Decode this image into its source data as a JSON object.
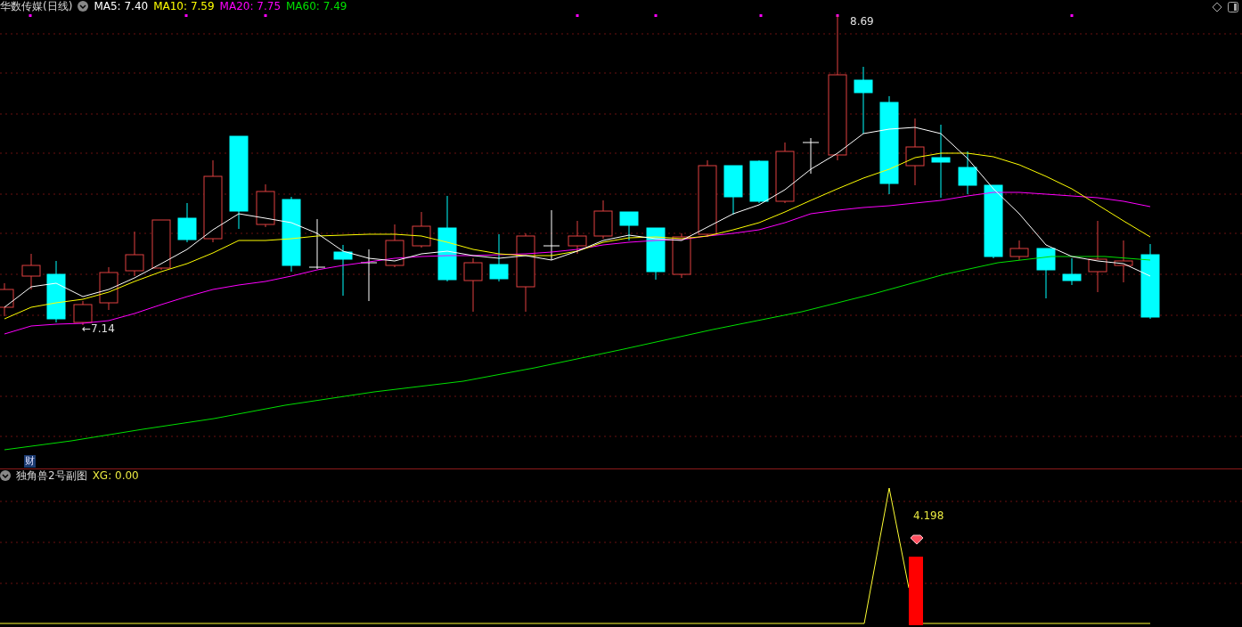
{
  "main_chart": {
    "title": "华数传媒(日线)",
    "indicators": [
      {
        "label": "MA5:",
        "value": "7.40",
        "color": "#ffffff"
      },
      {
        "label": "MA10:",
        "value": "7.59",
        "color": "#ffff00"
      },
      {
        "label": "MA20:",
        "value": "7.75",
        "color": "#ff00ff"
      },
      {
        "label": "MA60:",
        "value": "7.49",
        "color": "#00e000"
      }
    ],
    "high_label": "8.69",
    "low_label": "←7.14",
    "finance_badge": "财"
  },
  "sub_chart": {
    "title": "独角兽2号副图",
    "xg": "XG: 0.00",
    "peak_label": "4.198"
  }
}
